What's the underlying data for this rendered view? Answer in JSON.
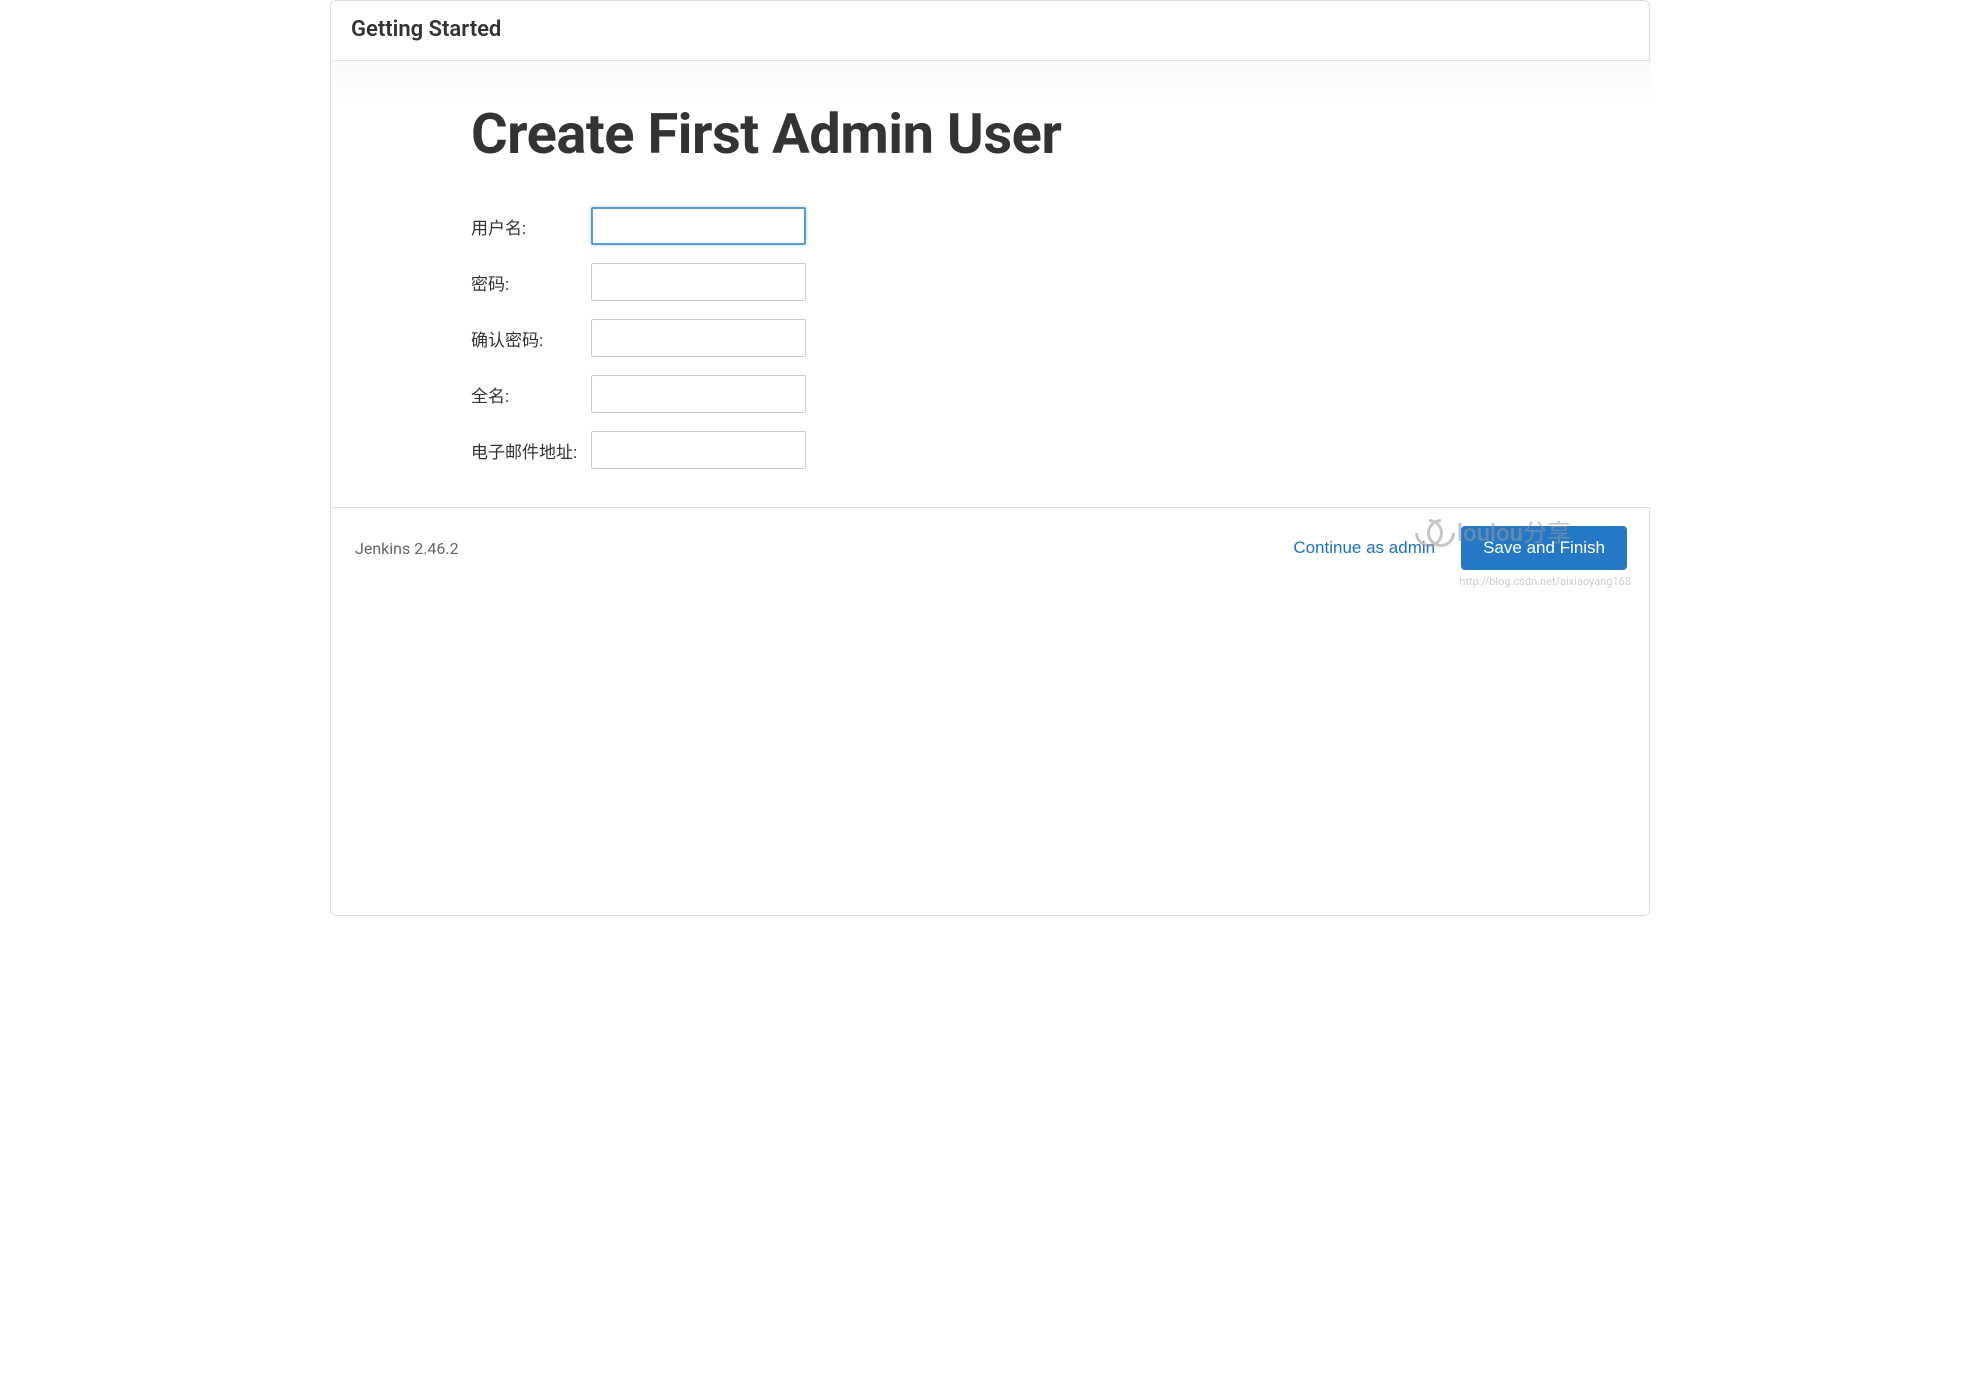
{
  "header": {
    "title": "Getting Started"
  },
  "main": {
    "heading": "Create First Admin User",
    "form": {
      "fields": [
        {
          "label": "用户名:",
          "value": "",
          "focused": true,
          "name": "username"
        },
        {
          "label": "密码:",
          "value": "",
          "focused": false,
          "name": "password"
        },
        {
          "label": "确认密码:",
          "value": "",
          "focused": false,
          "name": "confirm-password"
        },
        {
          "label": "全名:",
          "value": "",
          "focused": false,
          "name": "fullname"
        },
        {
          "label": "电子邮件地址:",
          "value": "",
          "focused": false,
          "name": "email"
        }
      ]
    }
  },
  "footer": {
    "version": "Jenkins 2.46.2",
    "continue_link": "Continue as admin",
    "save_button": "Save and Finish"
  },
  "watermark": {
    "text": "loulou分享",
    "url": "http://blog.csdn.net/aixiaoyang168"
  }
}
